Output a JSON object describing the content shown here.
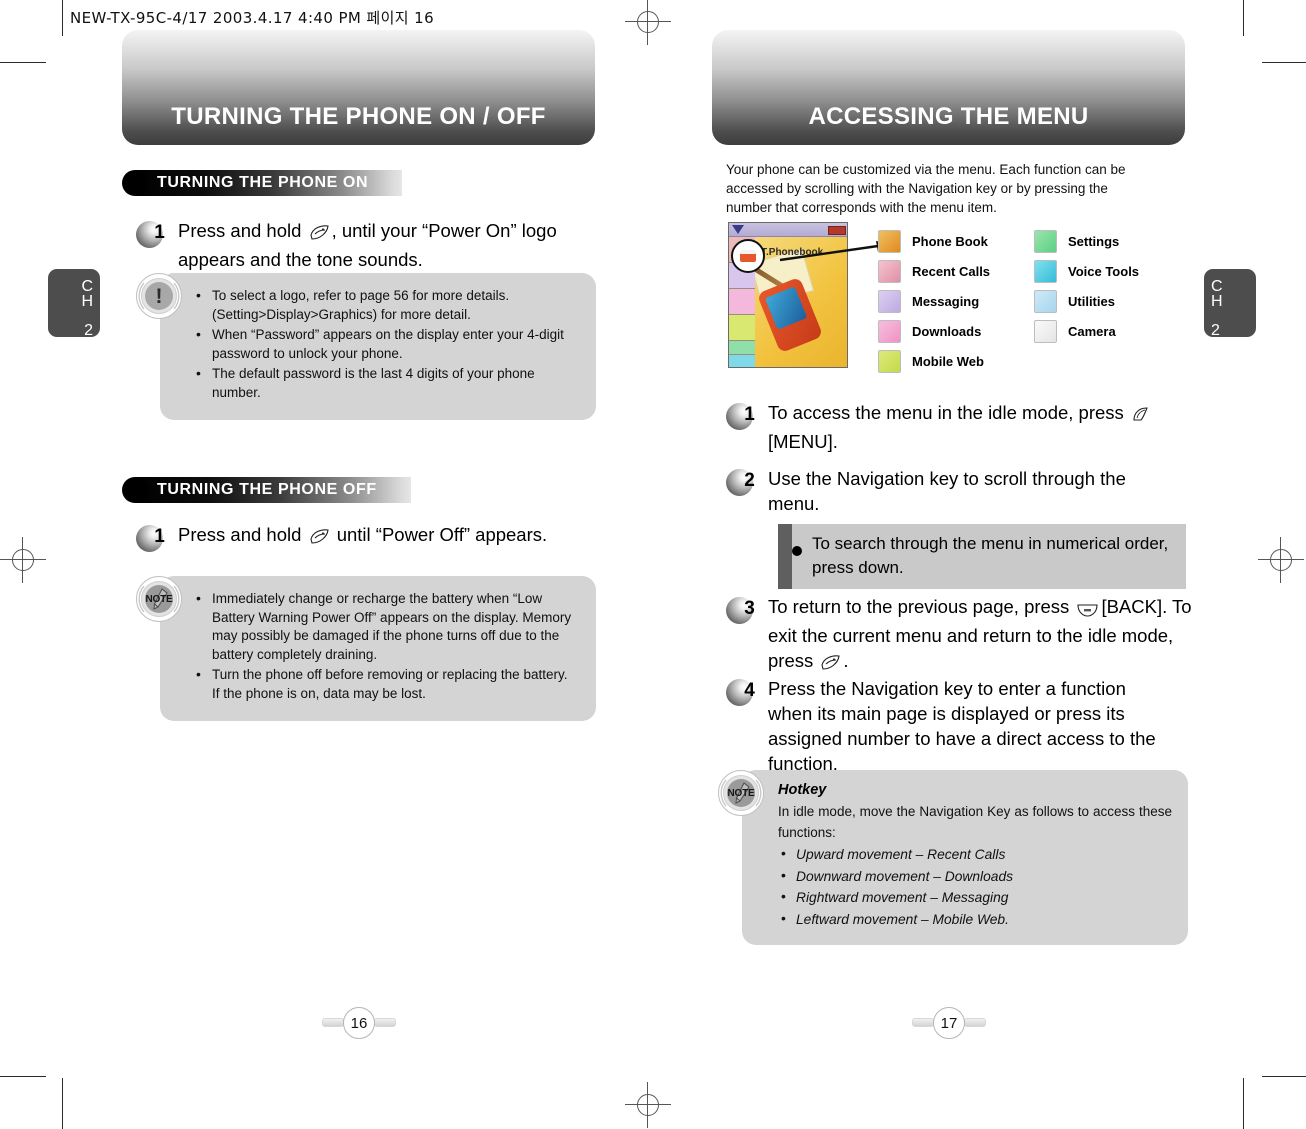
{
  "doc": {
    "header": "NEW-TX-95C-4/17  2003.4.17 4:40 PM  페이지 16"
  },
  "left_page": {
    "banner_title": "TURNING THE PHONE ON / OFF",
    "chapter_tab": {
      "line1": "C",
      "line2": "H",
      "line3": "2"
    },
    "page_number": "16",
    "section_on": {
      "header": "TURNING THE PHONE ON",
      "steps": [
        {
          "number": "1",
          "text_before": "Press and hold",
          "icon": "end-key-icon",
          "text_after": ", until your “Power On” logo appears and the tone sounds."
        }
      ],
      "warning": {
        "badge": "exclamation-icon",
        "items": [
          "To select a logo, refer to page 56 for more details. (Setting>Display>Graphics) for more detail.",
          "When “Password” appears on the display enter your 4-digit password to unlock your phone.",
          "The default password is the last 4 digits of your phone number."
        ]
      }
    },
    "section_off": {
      "header": "TURNING THE PHONE OFF",
      "steps": [
        {
          "number": "1",
          "text_before": "Press and hold",
          "icon": "end-key-icon",
          "text_after": "until “Power Off” appears."
        }
      ],
      "note": {
        "badge": "NOTE",
        "items": [
          "Immediately change or recharge the battery when “Low Battery Warning Power Off” appears on the display. Memory may possibly be damaged if the phone turns off due to the battery completely draining.",
          "Turn the phone off before removing or replacing the battery. If the phone is on, data may be lost."
        ]
      }
    }
  },
  "right_page": {
    "banner_title": "ACCESSING THE MENU",
    "chapter_tab": {
      "line1": "C",
      "line2": "H",
      "line3": "2"
    },
    "page_number": "17",
    "intro": "Your phone can be customized via the menu. Each function can be accessed by scrolling with the Navigation key or by pressing the number that corresponds with the menu item.",
    "phone_screen": {
      "title_label": "T.Phonebook",
      "magnifier": "magnifier-icon",
      "battery": "battery-icon"
    },
    "menu_columns": [
      {
        "items": [
          {
            "label": "Phone Book",
            "icon": "phonebook-icon",
            "color": "#e8a030"
          },
          {
            "label": "Recent Calls",
            "icon": "recent-calls-icon",
            "color": "#e9a3b4"
          },
          {
            "label": "Messaging",
            "icon": "messaging-icon",
            "color": "#c9b6e8"
          },
          {
            "label": "Downloads",
            "icon": "downloads-icon",
            "color": "#f0a6d0"
          },
          {
            "label": "Mobile Web",
            "icon": "mobile-web-icon",
            "color": "#cde45f"
          }
        ]
      },
      {
        "items": [
          {
            "label": "Settings",
            "icon": "settings-icon",
            "color": "#79d88e"
          },
          {
            "label": "Voice Tools",
            "icon": "voice-tools-icon",
            "color": "#53cfe0"
          },
          {
            "label": "Utilities",
            "icon": "utilities-icon",
            "color": "#aee0f2"
          },
          {
            "label": "Camera",
            "icon": "camera-icon",
            "color": "#f0f0f0"
          }
        ]
      }
    ],
    "steps": [
      {
        "number": "1",
        "text_before": "To access the menu in the idle mode, press",
        "icon": "menu-key-icon",
        "text_after": "[MENU]."
      },
      {
        "number": "2",
        "text_before": "Use the Navigation key to scroll through the menu.",
        "icon": "",
        "text_after": ""
      },
      {
        "number": "3",
        "text_before": "To return to the previous page, press",
        "icon": "back-key-icon",
        "text_after": "[BACK]. To exit the current menu and return to the idle mode, press",
        "icon2": "end-key-icon",
        "text_end": "."
      },
      {
        "number": "4",
        "text_before": "Press the Navigation key to enter a function when its main page is displayed or press its assigned number to have a direct access to the function.",
        "icon": "",
        "text_after": ""
      }
    ],
    "tip": {
      "bullet": "bullet-icon",
      "text": "To search through the menu in numerical order, press down."
    },
    "hotkey_note": {
      "badge": "NOTE",
      "title": "Hotkey",
      "lead": "In idle mode, move the Navigation Key as follows to access these functions:",
      "items": [
        "Upward movement – Recent Calls",
        "Downward movement – Downloads",
        "Rightward movement – Messaging",
        "Leftward movement – Mobile Web."
      ]
    }
  },
  "colors": {
    "banner_dark": "#3d3d3d",
    "callout_bg": "#d4d4d4",
    "tip_bg": "#c9c9c9",
    "tip_bar": "#5f5f5f",
    "chapter_tab": "#4d4d4d"
  }
}
